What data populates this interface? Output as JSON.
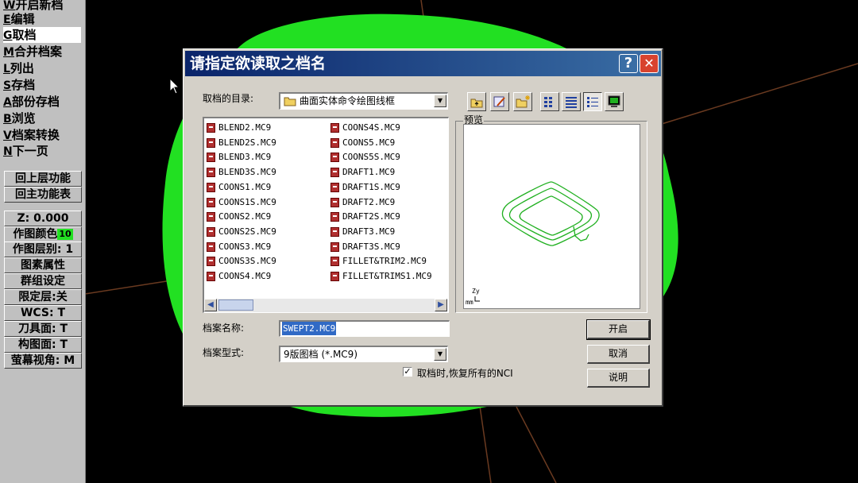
{
  "menu": {
    "items": [
      {
        "key": "W",
        "label": "开启新档"
      },
      {
        "key": "E",
        "label": "编辑"
      },
      {
        "key": "G",
        "label": "取档",
        "selected": true
      },
      {
        "key": "M",
        "label": "合并档案"
      },
      {
        "key": "L",
        "label": "列出"
      },
      {
        "key": "S",
        "label": "存档"
      },
      {
        "key": "A",
        "label": "部份存档"
      },
      {
        "key": "B",
        "label": "浏览"
      },
      {
        "key": "V",
        "label": "档案转换"
      },
      {
        "key": "N",
        "label": "下一页"
      }
    ],
    "nav": [
      "回上层功能",
      "回主功能表"
    ],
    "status": {
      "z": "Z:  0.000",
      "color_label": "作图颜色",
      "color_value": "10",
      "layer": "作图层别: 1",
      "attributes": "图素属性",
      "group": "群组设定",
      "limit_layer": "限定层:关",
      "wcs": "WCS:  T",
      "tool_plane": "刀具面: T",
      "construction_plane": "构图面: T",
      "view": "萤幕视角: M"
    }
  },
  "dialog": {
    "title": "请指定欲读取之档名",
    "help_button": "?",
    "close_button": "✕",
    "directory_label": "取档的目录:",
    "directory_value": "曲面实体命令绘图线框",
    "preview_label": "预览",
    "files_left": [
      "BLEND2.MC9",
      "BLEND2S.MC9",
      "BLEND3.MC9",
      "BLEND3S.MC9",
      "COONS1.MC9",
      "COONS1S.MC9",
      "COONS2.MC9",
      "COONS2S.MC9",
      "COONS3.MC9",
      "COONS3S.MC9",
      "COONS4.MC9"
    ],
    "files_right": [
      "COONS4S.MC9",
      "COONS5.MC9",
      "COONS5S.MC9",
      "DRAFT1.MC9",
      "DRAFT1S.MC9",
      "DRAFT2.MC9",
      "DRAFT2S.MC9",
      "DRAFT3.MC9",
      "DRAFT3S.MC9",
      "FILLET&TRIM2.MC9",
      "FILLET&TRIMS1.MC9"
    ],
    "filename_label": "档案名称:",
    "filename_value": "SWEPT2.MC9",
    "filetype_label": "档案型式:",
    "filetype_value": "9版图档 (*.MC9)",
    "checkbox_label": "取档时,恢复所有的NCI",
    "checkbox_checked": true,
    "open_button": "开启",
    "cancel_button": "取消",
    "help_text_button": "说明"
  },
  "colors": {
    "blob_green": "#22e022",
    "title_start": "#0a246a",
    "title_end": "#3a6ea5",
    "close_red": "#d8432e",
    "preview_green": "#20b020",
    "axis_brown": "#8a4a2a"
  }
}
